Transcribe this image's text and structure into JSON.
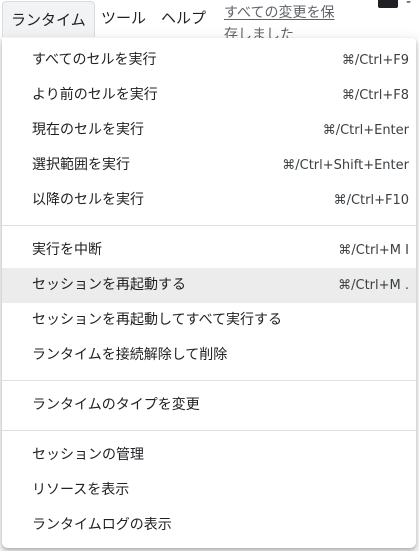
{
  "menubar": {
    "runtime": "ランタイム",
    "tools": "ツール",
    "help": "ヘルプ",
    "save_status": "すべての変更を保存しました"
  },
  "runtime_menu": {
    "groups": [
      [
        {
          "label": "すべてのセルを実行",
          "shortcut": "⌘/Ctrl+F9"
        },
        {
          "label": "より前のセルを実行",
          "shortcut": "⌘/Ctrl+F8"
        },
        {
          "label": "現在のセルを実行",
          "shortcut": "⌘/Ctrl+Enter"
        },
        {
          "label": "選択範囲を実行",
          "shortcut": "⌘/Ctrl+Shift+Enter"
        },
        {
          "label": "以降のセルを実行",
          "shortcut": "⌘/Ctrl+F10"
        }
      ],
      [
        {
          "label": "実行を中断",
          "shortcut": "⌘/Ctrl+M I"
        },
        {
          "label": "セッションを再起動する",
          "shortcut": "⌘/Ctrl+M ."
        },
        {
          "label": "セッションを再起動してすべて実行する",
          "shortcut": ""
        },
        {
          "label": "ランタイムを接続解除して削除",
          "shortcut": ""
        }
      ],
      [
        {
          "label": "ランタイムのタイプを変更",
          "shortcut": ""
        }
      ],
      [
        {
          "label": "セッションの管理",
          "shortcut": ""
        },
        {
          "label": "リソースを表示",
          "shortcut": ""
        },
        {
          "label": "ランタイムログの表示",
          "shortcut": ""
        }
      ]
    ]
  }
}
